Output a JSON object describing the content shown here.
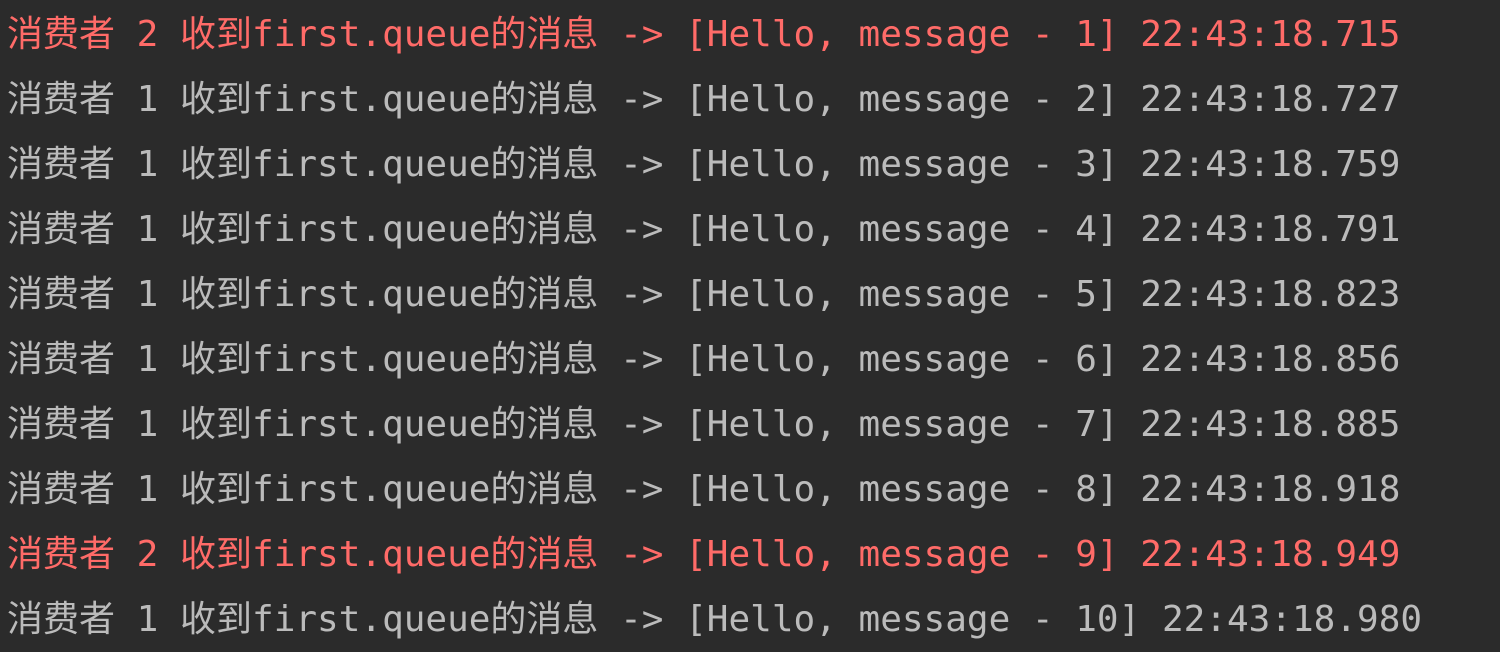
{
  "console": {
    "theme": {
      "background": "#2b2b2b",
      "normal_text": "#bbbbbb",
      "stderr_text": "#ff6b68"
    },
    "lines": [
      {
        "text": "消费者 2 收到first.queue的消息 -> [Hello, message - 1] 22:43:18.715",
        "stream": "stderr"
      },
      {
        "text": "消费者 1 收到first.queue的消息 -> [Hello, message - 2] 22:43:18.727",
        "stream": "stdout"
      },
      {
        "text": "消费者 1 收到first.queue的消息 -> [Hello, message - 3] 22:43:18.759",
        "stream": "stdout"
      },
      {
        "text": "消费者 1 收到first.queue的消息 -> [Hello, message - 4] 22:43:18.791",
        "stream": "stdout"
      },
      {
        "text": "消费者 1 收到first.queue的消息 -> [Hello, message - 5] 22:43:18.823",
        "stream": "stdout"
      },
      {
        "text": "消费者 1 收到first.queue的消息 -> [Hello, message - 6] 22:43:18.856",
        "stream": "stdout"
      },
      {
        "text": "消费者 1 收到first.queue的消息 -> [Hello, message - 7] 22:43:18.885",
        "stream": "stdout"
      },
      {
        "text": "消费者 1 收到first.queue的消息 -> [Hello, message - 8] 22:43:18.918",
        "stream": "stdout"
      },
      {
        "text": "消费者 2 收到first.queue的消息 -> [Hello, message - 9] 22:43:18.949",
        "stream": "stderr"
      },
      {
        "text": "消费者 1 收到first.queue的消息 -> [Hello, message - 10] 22:43:18.980",
        "stream": "stdout"
      }
    ]
  }
}
